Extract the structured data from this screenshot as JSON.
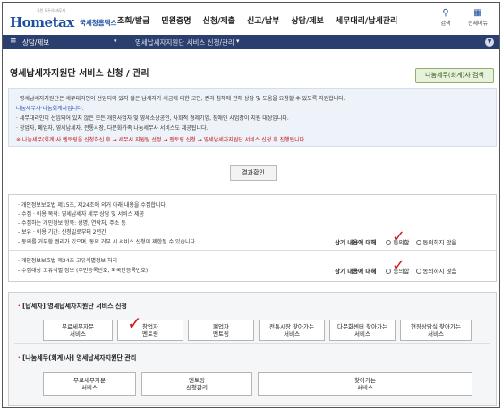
{
  "header": {
    "logo_tagline": "국민 모두의 세무서",
    "logo_brand": "Hometax",
    "logo_korean": "국세청홈택스",
    "menus": [
      "조회/발급",
      "민원증명",
      "신청/제출",
      "신고/납부",
      "상담/제보",
      "세무대리/납세관리"
    ],
    "search_label": "검색",
    "allmenu_label": "전체메뉴"
  },
  "navbar": {
    "menu_label": "상담/제보",
    "current_page": "영세납세자지원단 서비스 신청/관리"
  },
  "page": {
    "title": "영세납세자지원단 서비스 신청 / 관리",
    "green_button": "나눔세무(회계)사 검색"
  },
  "info": {
    "lines": [
      "· 영세납세자지원단은 세무대리인이 선임되어 있지 않은 납세자가 세금에 대한 고민, 권리 침해에 관해 상담 및 도움을 요청할 수 있도록 지원합니다.",
      "  나눔세무사·나눔회계사입니다.",
      "· 세무대리인이 선임되어 있지 않은 모든 개인사업자 및 영세소상공인, 사회적 경제기업, 장애인 사업장이 지원 대상입니다.",
      "· 창업자, 폐업자, 영세납세자, 전통시장, 다문화가족 나눔세무사 서비스도 제공됩니다.",
      "※ 나눔세무(회계)사 멘토링을 신청하신 후 → 세무서 지원팀 선정 → 멘토링 신청 → 영세납세자지원단 서비스 신청 후 진행됩니다."
    ]
  },
  "result_button": "결과확인",
  "consent": {
    "block1": [
      "· 개인정보보호법 제15조, 제24조에 의거 아래 내용을 수집합니다.",
      "  - 수집 · 이용 목적: 영세납세자 세무 상담 및 서비스 제공",
      "  - 수집하는 개인정보 항목: 성명, 연락처, 주소 등",
      "  - 보유 · 이용 기간: 신청일로부터 2년간",
      "  - 동의를 거부할 권리가 있으며, 동의 거부 시 서비스 신청이 제한될 수 있습니다."
    ],
    "block2": [
      "· 개인정보보호법 제24조 고유식별정보 처리",
      "  - 수집대상 고유식별 정보 (주민등록번호, 외국인등록번호)"
    ],
    "agree_label": "상기 내용에 대해",
    "agree": "동의함",
    "disagree": "동의하지 않음"
  },
  "services": {
    "section1_title": "[납세자] 영세납세자지원단 서비스 신청",
    "section1_buttons": [
      "무료세무자문\n서비스",
      "창업자\n멘토링",
      "폐업자\n멘토링",
      "전통시장 찾아가는\n서비스",
      "다문화센터 찾아가는\n서비스",
      "현장상담실 찾아가는\n서비스"
    ],
    "section2_title": "[나눔세무(회계)사] 영세납세자지원단 관리",
    "section2_buttons": [
      "무료세무자문\n서비스",
      "멘토링\n신청관리",
      "찾아가는\n서비스"
    ]
  },
  "colors": {
    "brand_blue": "#1c4fa0",
    "nav_bg": "#2b3f6e",
    "check_red": "#d11b1b"
  }
}
